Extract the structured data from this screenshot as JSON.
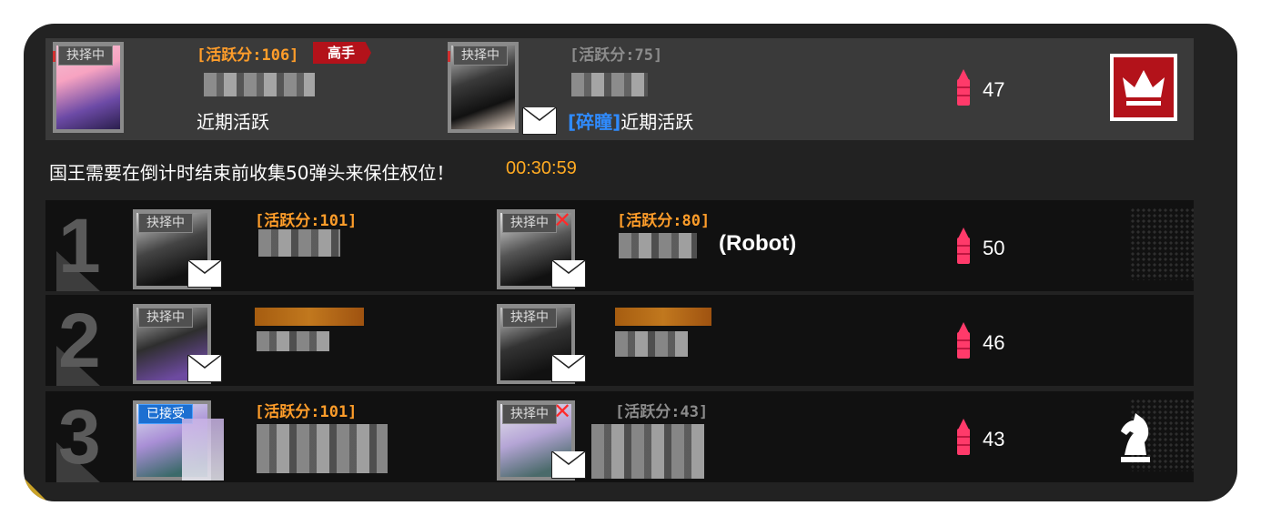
{
  "king": {
    "member1": {
      "tag": "抉择中",
      "score": "[活跃分:106]",
      "rank_badge": "高手",
      "status": "近期活跃"
    },
    "member2": {
      "tag": "抉择中",
      "score": "[活跃分:75]",
      "guild": "[碎瞳]",
      "status": "近期活跃"
    },
    "ammo": "47",
    "icon": "crown-icon"
  },
  "notice": "国王需要在倒计时结束前收集50弹头来保住权位！",
  "timer": "00:30:59",
  "ranks": [
    {
      "rank": "1",
      "m1": {
        "tag": "抉择中",
        "score": "[活跃分:101]"
      },
      "m2": {
        "tag": "抉择中",
        "score": "[活跃分:80]",
        "suffix": "(Robot)"
      },
      "ammo": "50"
    },
    {
      "rank": "2",
      "m1": {
        "tag": "抉择中"
      },
      "m2": {
        "tag": "抉择中"
      },
      "ammo": "46"
    },
    {
      "rank": "3",
      "m1": {
        "tag": "已接受",
        "score": "[活跃分:101]"
      },
      "m2": {
        "tag": "抉择中",
        "score": "[活跃分:43]"
      },
      "ammo": "43",
      "icon": "knight-chess-icon"
    }
  ],
  "colors": {
    "accent_orange": "#ff9d2a",
    "timer": "#ffaa22",
    "ammo": "#ff3a6a",
    "crown_bg": "#b3121a",
    "guild_blue": "#2f8bff"
  }
}
